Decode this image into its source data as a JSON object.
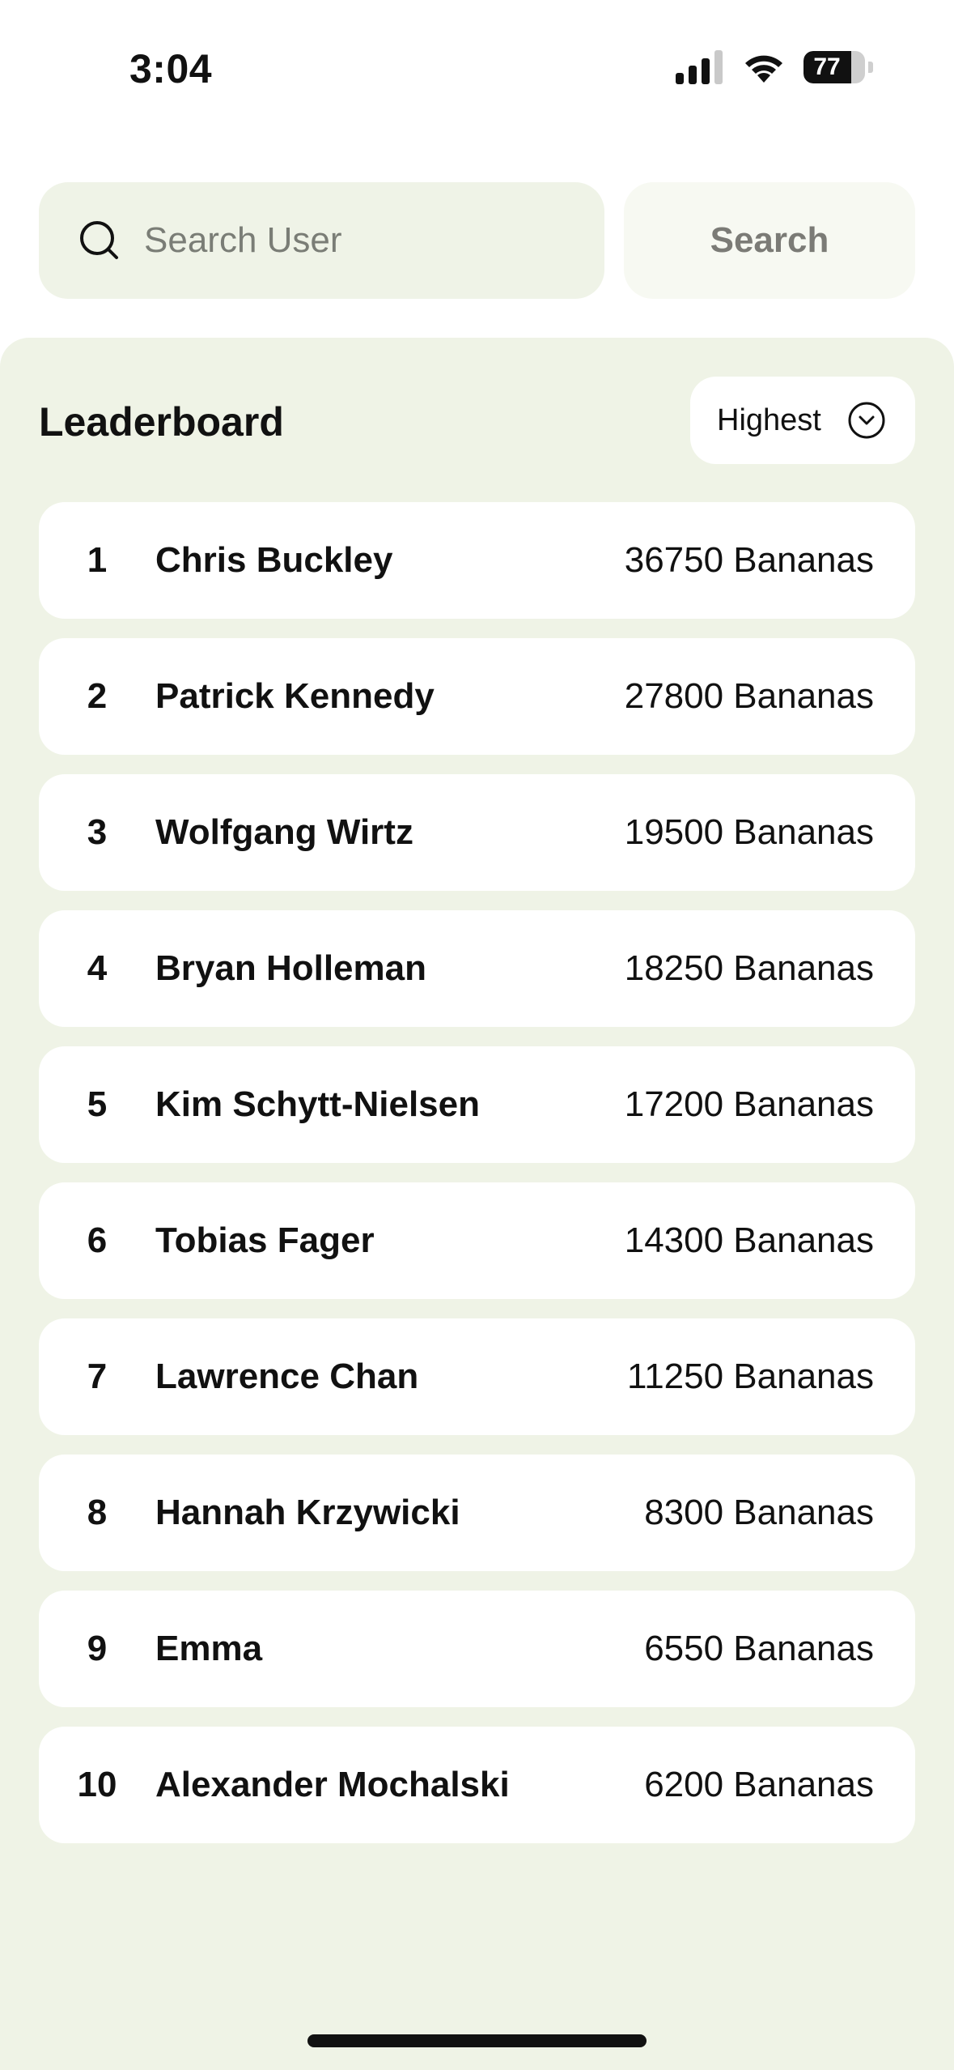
{
  "status_bar": {
    "time": "3:04",
    "battery_level": "77",
    "battery_fraction": 0.77
  },
  "search": {
    "placeholder": "Search User",
    "value": "",
    "button_label": "Search"
  },
  "leaderboard": {
    "title": "Leaderboard",
    "sort_label": "Highest",
    "rows": [
      {
        "rank": "1",
        "name": "Chris Buckley",
        "score": "36750 Bananas"
      },
      {
        "rank": "2",
        "name": "Patrick Kennedy",
        "score": "27800 Bananas"
      },
      {
        "rank": "3",
        "name": "Wolfgang Wirtz",
        "score": "19500 Bananas"
      },
      {
        "rank": "4",
        "name": "Bryan Holleman",
        "score": "18250 Bananas"
      },
      {
        "rank": "5",
        "name": "Kim Schytt-Nielsen",
        "score": "17200 Bananas"
      },
      {
        "rank": "6",
        "name": "Tobias Fager",
        "score": "14300 Bananas"
      },
      {
        "rank": "7",
        "name": "Lawrence Chan",
        "score": "11250 Bananas"
      },
      {
        "rank": "8",
        "name": "Hannah Krzywicki",
        "score": "8300 Bananas"
      },
      {
        "rank": "9",
        "name": "Emma",
        "score": "6550 Bananas"
      },
      {
        "rank": "10",
        "name": "Alexander Mochalski",
        "score": "6200 Bananas"
      }
    ]
  },
  "icons": {
    "signal": "cellular-signal-icon",
    "wifi": "wifi-icon",
    "battery": "battery-icon",
    "search": "search-icon",
    "sort": "chevron-down-circle-icon"
  },
  "colors": {
    "panel_background": "#eff3e6",
    "search_field_background": "#eff3e7",
    "search_button_background": "#f7f9f2",
    "row_background": "#ffffff",
    "text": "#111111",
    "muted_text": "#7b7b76"
  }
}
